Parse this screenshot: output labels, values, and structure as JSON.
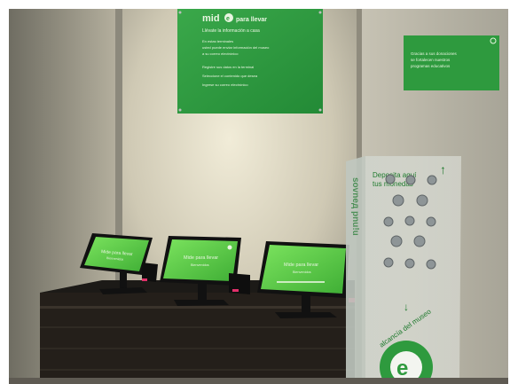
{
  "banner": {
    "title": "mid",
    "title_suffix": "para llevar",
    "subtitle": "Llévate la información a casa",
    "lines": [
      "En estas terminales",
      "usted puede enviar información del museo",
      "a su correo electrónico"
    ],
    "bullets": [
      "Registre sus datos en la terminal",
      "Seleccione el contenido que desea",
      "Ingrese su correo electrónico"
    ]
  },
  "sign_right": {
    "lines": [
      "Gracias a sus donaciones",
      "se fortalecen nuestros",
      "programas educativos"
    ]
  },
  "kiosks": [
    {
      "title": "Mide para llevar",
      "sub": "Bienvenidos"
    },
    {
      "title": "Mide para llevar",
      "sub": "Bienvenidos"
    },
    {
      "title": "Mide para llevar",
      "sub": "Bienvenidos"
    }
  ],
  "donation_box": {
    "heading_line1": "Deposita aquí",
    "heading_line2": "tus monedas",
    "side_text": "alcancía del museo",
    "vertical_text": "sovneд pnu!u"
  },
  "colors": {
    "accent_green": "#2e9a3e",
    "screen_green": "#5fd34a",
    "wall": "#d9d5c6"
  }
}
